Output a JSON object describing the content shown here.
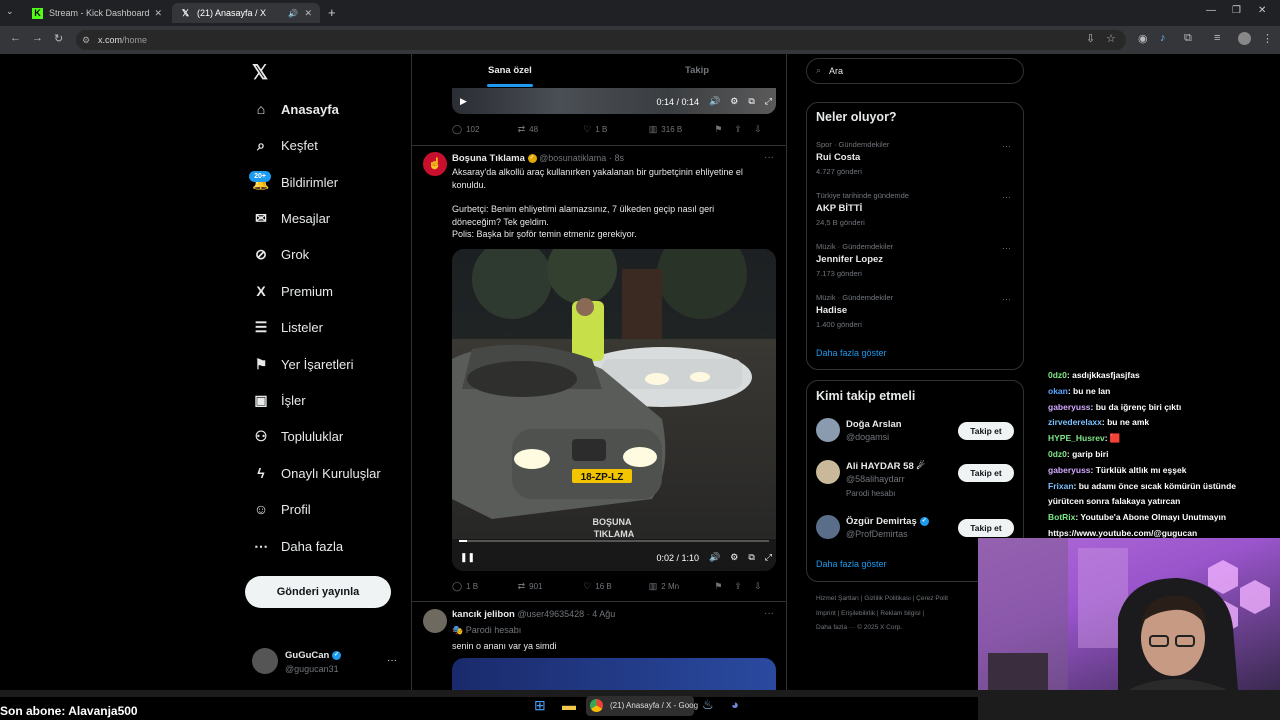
{
  "browser": {
    "tabs": [
      {
        "label": "Stream - Kick Dashboard",
        "icon": "kick-icon"
      },
      {
        "label": "(21) Anasayfa / X",
        "icon": "x-icon"
      }
    ],
    "new_tab": "+",
    "url_host": "x.com",
    "url_path": "/home"
  },
  "sidebar": {
    "items": [
      {
        "label": "Anasayfa",
        "icon": "home-icon",
        "glyph": "⌂"
      },
      {
        "label": "Keşfet",
        "icon": "search-icon",
        "glyph": "⌕"
      },
      {
        "label": "Bildirimler",
        "icon": "bell-icon",
        "glyph": "🔔"
      },
      {
        "label": "Mesajlar",
        "icon": "mail-icon",
        "glyph": "✉"
      },
      {
        "label": "Grok",
        "icon": "grok-icon",
        "glyph": "⊘"
      },
      {
        "label": "Premium",
        "icon": "x-logo-icon",
        "glyph": "X"
      },
      {
        "label": "Listeler",
        "icon": "list-icon",
        "glyph": "☰"
      },
      {
        "label": "Yer İşaretleri",
        "icon": "bookmark-icon",
        "glyph": "⚑"
      },
      {
        "label": "İşler",
        "icon": "briefcase-icon",
        "glyph": "▣"
      },
      {
        "label": "Topluluklar",
        "icon": "communities-icon",
        "glyph": "⚇"
      },
      {
        "label": "Onaylı Kuruluşlar",
        "icon": "bolt-icon",
        "glyph": "ϟ"
      },
      {
        "label": "Profil",
        "icon": "profile-icon",
        "glyph": "☺"
      },
      {
        "label": "Daha fazla",
        "icon": "more-circle-icon",
        "glyph": "⋯"
      }
    ],
    "notif_badge": "20+",
    "post_button": "Gönderi yayınla",
    "account": {
      "name": "GuGuCan",
      "handle": "@gugucan31",
      "more": "···"
    }
  },
  "feed": {
    "tabs": [
      "Sana özel",
      "Takip"
    ],
    "top_video": {
      "time": "0:14 / 0:14"
    },
    "top_actions": {
      "replies": "102",
      "reposts": "48",
      "likes": "1 B",
      "views": "316 B"
    },
    "tweet1": {
      "name": "Boşuna Tıklama",
      "handle": "@bosunatiklama",
      "time": "· 8s",
      "line1": "Aksaray'da alkollü araç kullanırken yakalanan bir gurbetçinin ehliyetine el",
      "line2": "konuldu.",
      "line3": "Gurbetçi: Benim ehliyetimi alamazsınız, 7 ülkeden geçip nasıl geri",
      "line4": "döneceğim? Tek geldim.",
      "line5": "Polis: Başka bir şoför temin etmeniz gerekiyor.",
      "plate": "18-ZP-LZ",
      "watermark1": "BOŞUNA",
      "watermark2": "TIKLAMA",
      "video_time": "0:02 / 1:10",
      "actions": {
        "replies": "1 B",
        "reposts": "901",
        "likes": "16 B",
        "views": "2 Mn"
      }
    },
    "tweet2": {
      "name": "kancık jelibon",
      "handle": "@user49635428",
      "time": "· 4 Ağu",
      "badge": "Parodi hesabı",
      "text": "senin o ananı var ya simdi"
    }
  },
  "right": {
    "search_placeholder": "Ara",
    "trends_title": "Neler oluyor?",
    "trends": [
      {
        "cat": "Spor · Gündemdekiler",
        "name": "Rui Costa",
        "count": "4.727 gönderi"
      },
      {
        "cat": "Türkiye tarihinde gündemde",
        "name": "AKP BİTTİ",
        "count": "24,5 B gönderi"
      },
      {
        "cat": "Müzik · Gündemdekiler",
        "name": "Jennifer Lopez",
        "count": "7.173 gönderi"
      },
      {
        "cat": "Müzik · Gündemdekiler",
        "name": "Hadise",
        "count": "1.400 gönderi"
      }
    ],
    "trends_more": "Daha fazla göster",
    "follow_title": "Kimi takip etmeli",
    "follow": [
      {
        "name": "Doğa Arslan",
        "handle": "@dogamsi",
        "badge": ""
      },
      {
        "name": "Ali HAYDAR 58 ☄",
        "handle": "@58alihaydarr",
        "badge": "Parodi hesabı"
      },
      {
        "name": "Özgür Demirtaş",
        "handle": "@ProfDemirtas",
        "badge": ""
      }
    ],
    "follow_btn": "Takip et",
    "follow_more": "Daha fazla göster",
    "footer1": "Hizmet Şartları | Gizlilik Politikası | Çerez Polit",
    "footer2": "Imprint | Erişilebilirlik | Reklam bilgisi |",
    "footer3": "Daha fazla ··· © 2025 X Corp."
  },
  "chat": [
    {
      "user": "0dz0",
      "msg": ": asdıjkkasfjasjfas",
      "color": "#7ee787"
    },
    {
      "user": "okan",
      "msg": ": bu ne lan",
      "color": "#58a6ff"
    },
    {
      "user": "gaberyuss",
      "msg": ": bu da iğrenç biri çıktı",
      "color": "#d2a8ff"
    },
    {
      "user": "zirvederelaxx",
      "msg": ": bu ne amk",
      "color": "#79c0ff"
    },
    {
      "user": "HYPE_Husrev",
      "msg": ": 🟥",
      "color": "#7ee787"
    },
    {
      "user": "0dz0",
      "msg": ": garip biri",
      "color": "#7ee787"
    },
    {
      "user": "gaberyuss",
      "msg": ": Türklük altlık mı eşşek",
      "color": "#d2a8ff"
    },
    {
      "user": "Frixan",
      "msg": ": bu adamı önce sıcak kömürün üstünde",
      "color": "#79c0ff"
    },
    {
      "user": "",
      "msg": "yürütcen sonra falakaya yatırcan",
      "color": "#fff"
    },
    {
      "user": "BotRix",
      "msg": ": Youtube'a Abone Olmayı Unutmayın",
      "color": "#7ee787"
    },
    {
      "user": "",
      "msg": "https://www.youtube.com/@gugucan",
      "color": "#fff"
    }
  ],
  "overlay": {
    "last_sub": "Son abone: Alavanja500"
  },
  "taskbar": {
    "chrome_label": "(21) Anasayfa / X - Goog"
  }
}
